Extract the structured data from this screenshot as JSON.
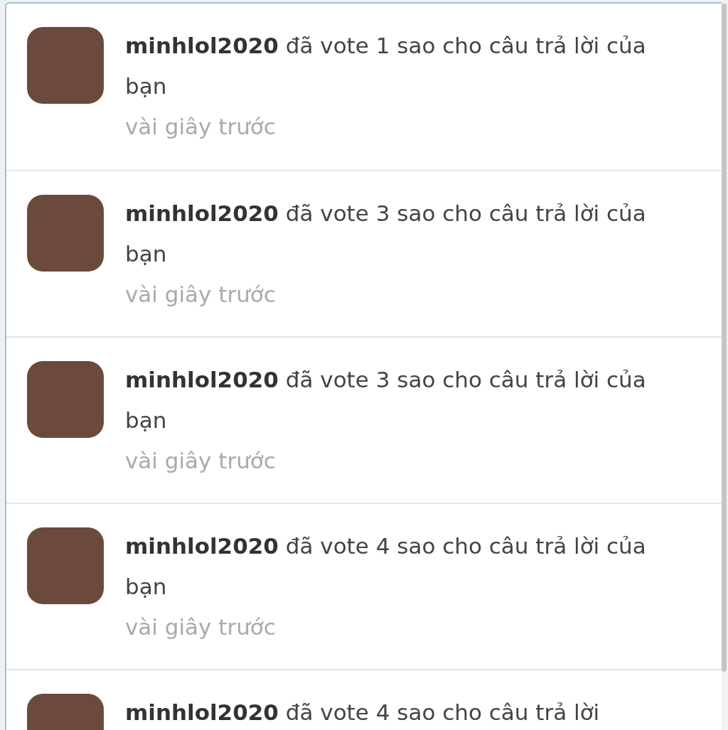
{
  "notifications": [
    {
      "text": "**minhlol2020**  đã vote 1 sao cho câu trả lời của bạn",
      "time": "vài giây trước"
    },
    {
      "text": "**minhlol2020**  đã vote 3 sao cho câu trả lời của bạn",
      "time": "vài giây trước"
    },
    {
      "text": "**minhlol2020**  đã vote 3 sao cho câu trả lời của bạn",
      "time": "vài giây trước"
    },
    {
      "text": "**minhlol2020**  đã vote 4 sao cho câu trả lời của bạn",
      "time": "vài giây trước"
    },
    {
      "text": "**minhlol2020**  đã vote 4 sao cho câu trả lời"
    }
  ]
}
